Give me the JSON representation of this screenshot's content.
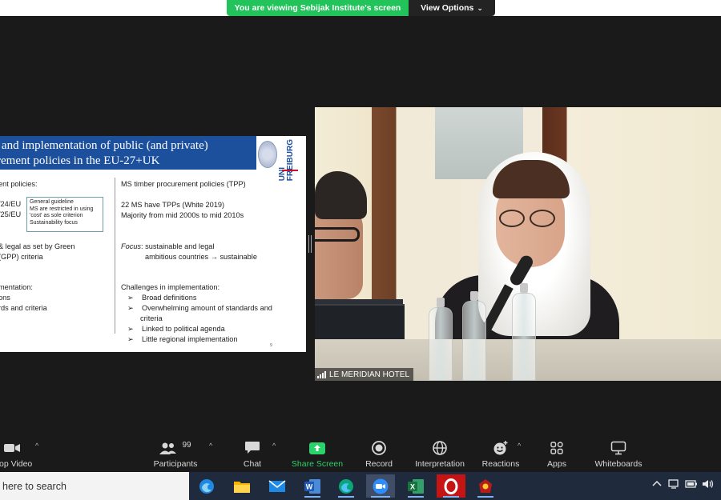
{
  "banner": {
    "message": "You are viewing Sebijak Institute's screen",
    "options_label": "View Options",
    "options_caret": "⌄"
  },
  "slide": {
    "title_line1": "t and implementation of public (and private)",
    "title_line2": "rement policies in the EU-27+UK",
    "logo_text": "UNI FREIBURG",
    "left": {
      "heading": "ent policies:",
      "l1": "/24/EU",
      "l2": "/25/EU",
      "box_lines": [
        "General guideline",
        "MS are restricted in using",
        "'cost' as sole criterion",
        "Sustainability focus"
      ],
      "gpp1": "& legal as set by Green",
      "gpp2": "(GPP) criteria",
      "impl_heading": "mentation:",
      "impl1": "ons",
      "impl2": "rds and criteria"
    },
    "right": {
      "heading": "MS timber procurement policies (TPP)",
      "p1": "22 MS have TPPs (White 2019)",
      "p2": "Majority from mid 2000s to mid 2010s",
      "focus_label": "Focus",
      "focus_text": ": sustainable and legal",
      "focus2": "ambitious countries → sustainable",
      "challenges_heading": "Challenges in implementation:",
      "bullet_marker": "➢",
      "bullets": [
        "Broad definitions",
        "Overwhelming amount of standards and",
        "Linked to political agenda",
        "Little regional implementation"
      ],
      "bullet2_cont": "criteria"
    },
    "page_number": "9"
  },
  "video": {
    "participant_label": "LE MERIDIAN HOTEL"
  },
  "controls": {
    "video_label": "op Video",
    "participants_label": "Participants",
    "participants_count": "99",
    "chat_label": "Chat",
    "share_label": "Share Screen",
    "record_label": "Record",
    "interpretation_label": "Interpretation",
    "reactions_label": "Reactions",
    "apps_label": "Apps",
    "whiteboards_label": "Whiteboards",
    "caret": "^"
  },
  "taskbar": {
    "search_text": "here to search",
    "excel_letter": "X",
    "word_letter": "W"
  },
  "colors": {
    "share_green": "#2bd16b",
    "banner_green": "#21c35a",
    "slide_header_blue": "#1c4f9c",
    "taskbar_bg": "#1f2a3d"
  }
}
